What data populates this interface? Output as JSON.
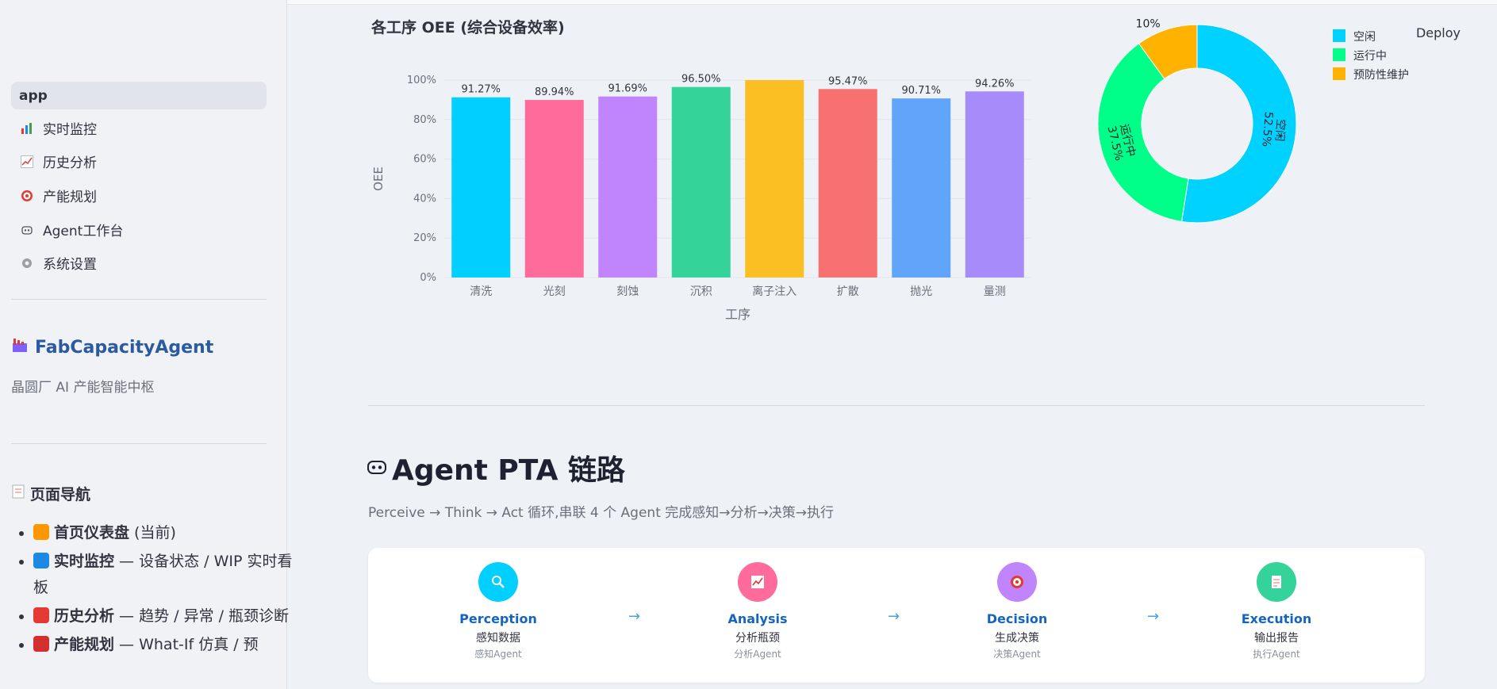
{
  "sidebar": {
    "items": [
      {
        "label": "app",
        "icon": "",
        "active": true
      },
      {
        "label": "实时监控",
        "icon": "bar-chart-icon"
      },
      {
        "label": "历史分析",
        "icon": "trend-chart-icon"
      },
      {
        "label": "产能规划",
        "icon": "target-icon"
      },
      {
        "label": "Agent工作台",
        "icon": "robot-icon"
      },
      {
        "label": "系统设置",
        "icon": "gear-icon"
      }
    ],
    "brand_title": "FabCapacityAgent",
    "brand_sub": "晶圆厂 AI 产能智能中枢",
    "page_nav_title": "页面导航",
    "page_nav": [
      {
        "bold": "首页仪表盘",
        "rest": " (当前)"
      },
      {
        "bold": "实时监控",
        "rest": " — 设备状态 / WIP 实时看板"
      },
      {
        "bold": "历史分析",
        "rest": " — 趋势 / 异常 / 瓶颈诊断"
      },
      {
        "bold": "产能规划",
        "rest": " — What-If 仿真 / 预"
      }
    ]
  },
  "header": {
    "deploy_label": "Deploy"
  },
  "chart_title": "各工序 OEE (综合设备效率)",
  "chart_data": [
    {
      "type": "bar",
      "categories": [
        "清洗",
        "光刻",
        "刻蚀",
        "沉积",
        "离子注入",
        "扩散",
        "抛光",
        "量测"
      ],
      "values": [
        91.27,
        89.94,
        91.69,
        96.5,
        100.0,
        95.47,
        90.71,
        94.26
      ],
      "value_labels": [
        "91.27%",
        "89.94%",
        "91.69%",
        "96.50%",
        "",
        "95.47%",
        "90.71%",
        "94.26%"
      ],
      "colors": [
        "#00cfff",
        "#ff6b9a",
        "#c084fc",
        "#34d399",
        "#fbbf24",
        "#f87171",
        "#60a5fa",
        "#a78bfa"
      ],
      "xlabel": "工序",
      "ylabel": "OEE",
      "ylim": [
        0,
        100
      ],
      "yticks": [
        "0%",
        "20%",
        "40%",
        "60%",
        "80%",
        "100%"
      ],
      "grid": true
    },
    {
      "type": "pie",
      "hole": true,
      "labels": [
        "空闲",
        "运行中",
        "预防性维护"
      ],
      "values": [
        52.5,
        37.5,
        10
      ],
      "value_labels": [
        "52.5%",
        "37.5%",
        "10%"
      ],
      "colors": [
        "#00d2ff",
        "#00ff88",
        "#ffb300"
      ],
      "legend_position": "top-right"
    }
  ],
  "pta": {
    "title": "Agent PTA 链路",
    "subtitle": "Perceive → Think → Act 循环,串联 4 个 Agent 完成感知→分析→决策→执行",
    "stages": [
      {
        "name": "Perception",
        "desc": "感知数据",
        "agent": "感知Agent",
        "color": "#00cfff",
        "icon": "magnifier-icon"
      },
      {
        "name": "Analysis",
        "desc": "分析瓶颈",
        "agent": "分析Agent",
        "color": "#ff6b9a",
        "icon": "chart-icon"
      },
      {
        "name": "Decision",
        "desc": "生成决策",
        "agent": "决策Agent",
        "color": "#c084fc",
        "icon": "target-icon"
      },
      {
        "name": "Execution",
        "desc": "输出报告",
        "agent": "执行Agent",
        "color": "#34d399",
        "icon": "report-icon"
      }
    ]
  }
}
